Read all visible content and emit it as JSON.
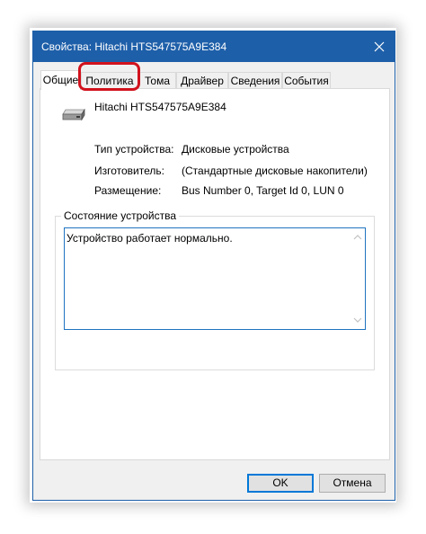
{
  "window": {
    "title": "Свойства: Hitachi HTS547575A9E384"
  },
  "tabs": [
    {
      "label": "Общие",
      "active": true
    },
    {
      "label": "Политика",
      "active": false,
      "highlighted": true
    },
    {
      "label": "Тома",
      "active": false
    },
    {
      "label": "Драйвер",
      "active": false
    },
    {
      "label": "Сведения",
      "active": false
    },
    {
      "label": "События",
      "active": false
    }
  ],
  "device": {
    "icon": "hard-drive-icon",
    "name": "Hitachi HTS547575A9E384",
    "properties": [
      {
        "label": "Тип устройства:",
        "value": "Дисковые устройства"
      },
      {
        "label": "Изготовитель:",
        "value": "(Стандартные дисковые накопители)"
      },
      {
        "label": "Размещение:",
        "value": "Bus Number 0, Target Id 0, LUN 0"
      }
    ]
  },
  "status_group": {
    "legend": "Состояние устройства",
    "text": "Устройство работает нормально."
  },
  "buttons": {
    "ok": "OK",
    "cancel": "Отмена"
  },
  "colors": {
    "titlebar": "#1e5fa9",
    "highlight": "#d1121d",
    "focus_border": "#1f73c2"
  }
}
